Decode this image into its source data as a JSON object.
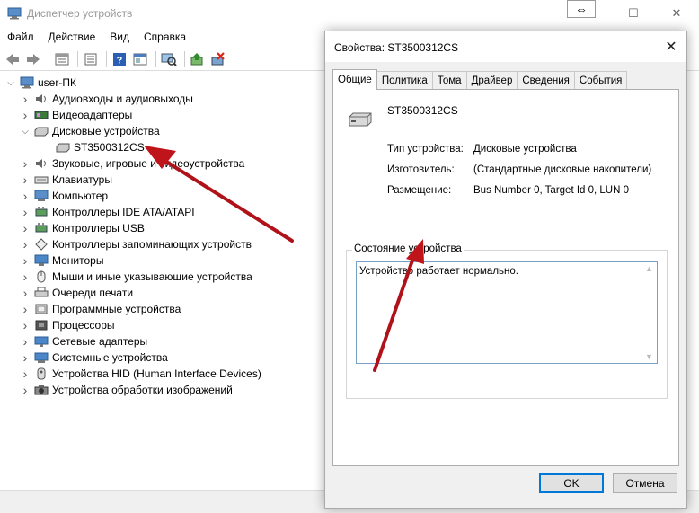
{
  "window": {
    "title": "Диспетчер устройств",
    "controls": {
      "minimize": "─",
      "maximize": "☐",
      "close": "✕"
    },
    "resize_cursor": "⇔"
  },
  "menu": [
    "Файл",
    "Действие",
    "Вид",
    "Справка"
  ],
  "toolbar_icons": [
    "back-icon",
    "forward-icon",
    "show-hidden-icon",
    "properties-icon",
    "help-icon",
    "view-icon",
    "scan-hardware-icon",
    "update-driver-icon",
    "uninstall-device-icon"
  ],
  "tree": {
    "root": "user-ПК",
    "items": [
      {
        "label": "Аудиовходы и аудиовыходы",
        "icon": "audio-icon",
        "expanded": false
      },
      {
        "label": "Видеоадаптеры",
        "icon": "display-adapter-icon",
        "expanded": false
      },
      {
        "label": "Дисковые устройства",
        "icon": "disk-drive-icon",
        "expanded": true,
        "children": [
          "ST3500312CS"
        ]
      },
      {
        "label": "Звуковые, игровые и видеоустройства",
        "icon": "sound-icon",
        "expanded": false
      },
      {
        "label": "Клавиатуры",
        "icon": "keyboard-icon",
        "expanded": false
      },
      {
        "label": "Компьютер",
        "icon": "computer-icon",
        "expanded": false
      },
      {
        "label": "Контроллеры IDE ATA/ATAPI",
        "icon": "ide-controller-icon",
        "expanded": false
      },
      {
        "label": "Контроллеры USB",
        "icon": "usb-icon",
        "expanded": false
      },
      {
        "label": "Контроллеры запоминающих устройств",
        "icon": "storage-controller-icon",
        "expanded": false
      },
      {
        "label": "Мониторы",
        "icon": "monitor-icon",
        "expanded": false
      },
      {
        "label": "Мыши и иные указывающие устройства",
        "icon": "mouse-icon",
        "expanded": false
      },
      {
        "label": "Очереди печати",
        "icon": "printer-icon",
        "expanded": false
      },
      {
        "label": "Программные устройства",
        "icon": "software-device-icon",
        "expanded": false
      },
      {
        "label": "Процессоры",
        "icon": "processor-icon",
        "expanded": false
      },
      {
        "label": "Сетевые адаптеры",
        "icon": "network-icon",
        "expanded": false
      },
      {
        "label": "Системные устройства",
        "icon": "system-device-icon",
        "expanded": false
      },
      {
        "label": "Устройства HID (Human Interface Devices)",
        "icon": "hid-icon",
        "expanded": false
      },
      {
        "label": "Устройства обработки изображений",
        "icon": "imaging-icon",
        "expanded": false
      }
    ]
  },
  "dialog": {
    "title": "Свойства: ST3500312CS",
    "close": "✕",
    "tabs": [
      "Общие",
      "Политика",
      "Тома",
      "Драйвер",
      "Сведения",
      "События"
    ],
    "active_tab": "Общие",
    "device_name": "ST3500312CS",
    "properties": {
      "type_label": "Тип устройства:",
      "type_value": "Дисковые устройства",
      "maker_label": "Изготовитель:",
      "maker_value": "(Стандартные дисковые накопители)",
      "location_label": "Размещение:",
      "location_value": "Bus Number 0, Target Id 0, LUN 0"
    },
    "status_group_label": "Состояние устройства",
    "status_text": "Устройство работает нормально.",
    "ok": "OK",
    "cancel": "Отмена"
  },
  "colors": {
    "accent": "#0078d7",
    "arrow": "#c0141b"
  }
}
